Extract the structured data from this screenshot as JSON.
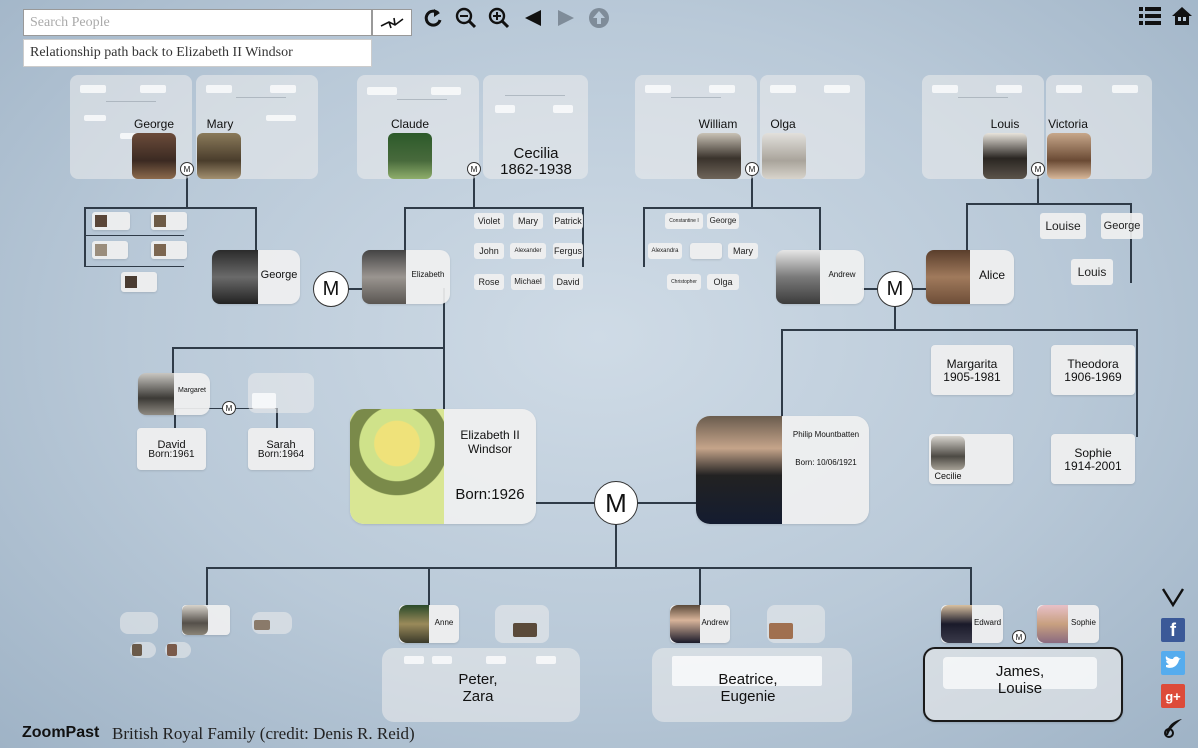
{
  "search": {
    "placeholder": "Search People",
    "path_hint": "Relationship path back to Elizabeth II Windsor"
  },
  "footer": {
    "brand": "ZoomPast",
    "caption": "British Royal Family (credit: Denis R. Reid)"
  },
  "marriage_label": "M",
  "top_ancestors": {
    "george_sr": "George",
    "mary": "Mary",
    "claude": "Claude",
    "cecilia": "Cecilia",
    "cecilia_dates": "1862-1938",
    "william": "William",
    "olga": "Olga",
    "louis_sr": "Louis",
    "victoria": "Victoria"
  },
  "bowes_lyon_children": {
    "col1": [
      "Violet",
      "John",
      "Rose"
    ],
    "col2": [
      "Mary",
      "Alexander",
      "Michael"
    ],
    "col3": [
      "Patrick",
      "Fergus",
      "David"
    ]
  },
  "greek_children": {
    "col1": [
      "Constantine I",
      "Alexandra",
      "Christopher"
    ],
    "col2": [
      "George",
      "Mary",
      "Olga"
    ]
  },
  "battenberg_children": {
    "louise": "Louise",
    "george": "George",
    "louis": "Louis"
  },
  "parents": {
    "george_vi": "George",
    "elizabeth": "Elizabeth",
    "andrew": "Andrew",
    "alice": "Alice"
  },
  "margaret": {
    "name": "Margaret",
    "children": [
      {
        "name": "David",
        "born": "Born:1961"
      },
      {
        "name": "Sarah",
        "born": "Born:1964"
      }
    ]
  },
  "philip_siblings": {
    "margarita": {
      "name": "Margarita",
      "dates": "1905-1981"
    },
    "theodora": {
      "name": "Theodora",
      "dates": "1906-1969"
    },
    "cecilie": {
      "name": "Cecilie"
    },
    "sophie": {
      "name": "Sophie",
      "dates": "1914-2001"
    }
  },
  "elizabeth_ii": {
    "name": "Elizabeth II\nWindsor",
    "born": "Born:1926"
  },
  "philip": {
    "name": "Philip Mountbatten",
    "born": "Born: 10/06/1921"
  },
  "children": {
    "anne": "Anne",
    "anne_kids": "Peter,\nZara",
    "andrew": "Andrew",
    "andrew_kids": "Beatrice,\nEugenie",
    "edward": "Edward",
    "sophie": "Sophie",
    "edward_kids": "James,\nLouise"
  },
  "colors": {
    "line": "#2f3b48",
    "background": "#b9c9d8",
    "card": "#f0f0f0"
  }
}
